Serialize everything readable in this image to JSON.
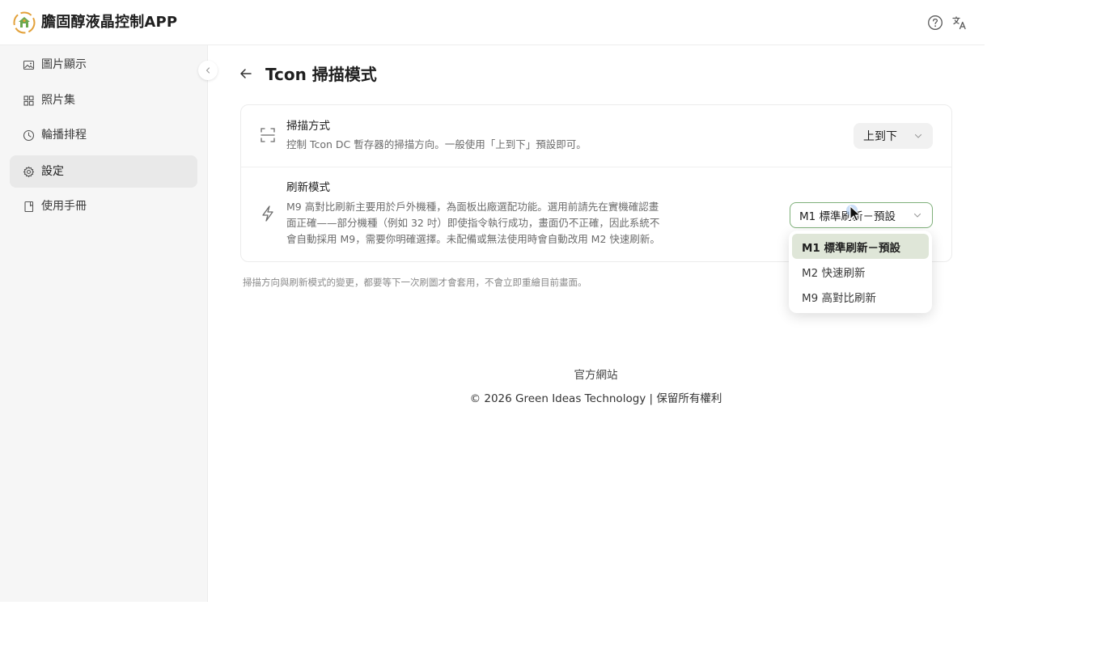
{
  "app": {
    "title": "膽固醇液晶控制APP",
    "logo_icon": "leaf-house-logo",
    "accent_color": "#7fb07a"
  },
  "header": {
    "help_icon": "question-circle-icon",
    "language_icon": "translate-icon"
  },
  "sidebar": {
    "items": [
      {
        "label": "圖片顯示",
        "icon": "image-icon",
        "active": false
      },
      {
        "label": "照片集",
        "icon": "grid-icon",
        "active": false
      },
      {
        "label": "輪播排程",
        "icon": "clock-icon",
        "active": false
      },
      {
        "label": "設定",
        "icon": "gear-icon",
        "active": true
      },
      {
        "label": "使用手冊",
        "icon": "book-icon",
        "active": false
      }
    ],
    "collapse_icon": "chevron-left-icon"
  },
  "page": {
    "title": "Tcon 掃描模式",
    "back_icon": "arrow-left-icon"
  },
  "scan_row": {
    "title": "掃描方式",
    "desc": "控制 Tcon DC 暫存器的掃描方向。一般使用「上到下」預設即可。",
    "icon": "scan-frame-icon",
    "value": "上到下"
  },
  "refresh_row": {
    "title": "刷新模式",
    "desc_line1": "M9 高對比刷新主要用於戶外機種，為面板出廠選配功能。選用前請先在實機確認畫",
    "desc_line2": "面正確——部分機種（例如 32 吋）即使指令執行成功，畫面仍不正確，因此系統不",
    "desc_line3": "會自動採用 M9，需要你明確選擇。未配備或無法使用時會自動改用 M2 快速刷新。",
    "icon": "lightning-icon",
    "value": "M1 標準刷新－預設",
    "options": [
      "M1 標準刷新－預設",
      "M2 快速刷新",
      "M9 高對比刷新"
    ],
    "selected_index": 0
  },
  "footnote": "掃描方向與刷新模式的變更，都要等下一次刷圖才會套用，不會立即重繪目前畫面。",
  "footer": {
    "link": "官方網站",
    "copyright": "© 2026 Green Ideas Technology | 保留所有權利"
  }
}
